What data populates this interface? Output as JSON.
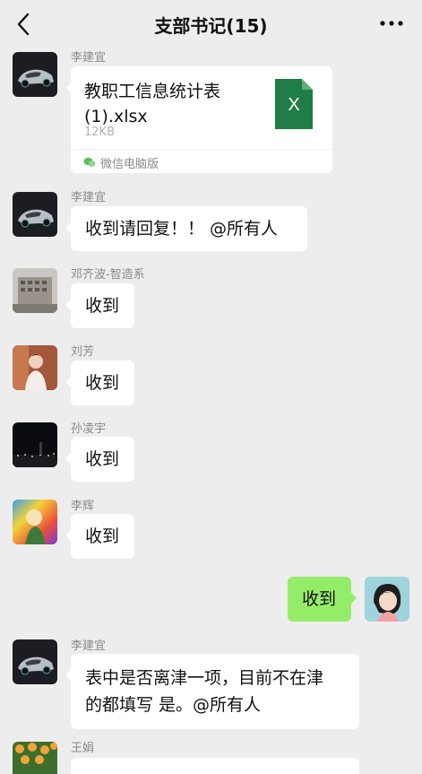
{
  "header": {
    "title": "支部书记(15)"
  },
  "messages": {
    "m1": {
      "sender": "李建宜",
      "file_name_line1": "教职工信息统计表",
      "file_name_line2": "(1).xlsx",
      "file_size": "12KB",
      "file_icon_letter": "X",
      "source": "微信电脑版"
    },
    "m2": {
      "sender": "李建宜",
      "text": "收到请回复！！ @所有人"
    },
    "m3": {
      "sender": "邓齐波-智造系",
      "text": "收到"
    },
    "m4": {
      "sender": "刘芳",
      "text": "收到"
    },
    "m5": {
      "sender": "孙凌宇",
      "text": "收到"
    },
    "m6": {
      "sender": "李辉",
      "text": "收到"
    },
    "m7": {
      "text": "收到"
    },
    "m8": {
      "sender": "李建宜",
      "line1": "表中是否离津一项，目前不在津",
      "line2": "的都填写 是。@所有人"
    },
    "m9": {
      "sender": "王娟"
    }
  },
  "colors": {
    "background": "#ededed",
    "my_bubble": "#95ec69",
    "excel_green": "#1f7d45"
  }
}
